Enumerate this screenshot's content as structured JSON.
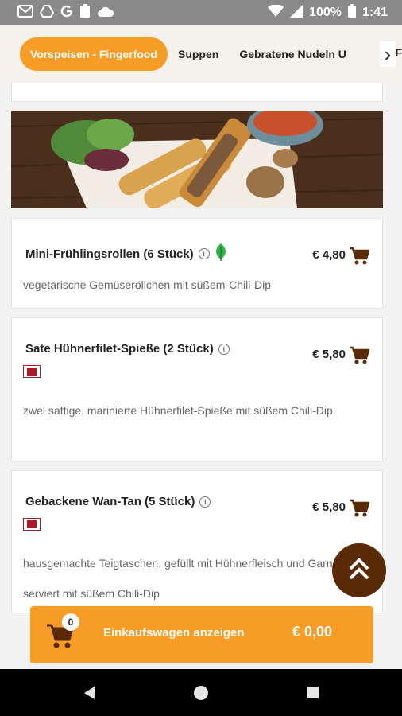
{
  "status": {
    "left_icons": [
      "gmail-icon",
      "drive-icon",
      "google-icon",
      "clipboard-icon",
      "cloud-icon"
    ],
    "battery": "100%",
    "time": "1:41"
  },
  "tabs": {
    "items": [
      "Vorspeisen - Fingerfood",
      "Suppen",
      "Gebratene Nudeln U"
    ],
    "edge_text": "F",
    "arrow": "›"
  },
  "products": [
    {
      "title": "Mini-Frühlingsrollen (6 Stück)",
      "price": "€ 4,80",
      "desc": "vegetarische Gemüseröllchen mit süßem-Chili-Dip",
      "badge": "vegetarian-leaf-icon"
    },
    {
      "title": "Sate Hühnerfilet-Spieße (2 Stück)",
      "price": "€ 5,80",
      "desc": "zwei saftige, marinierte Hühnerfilet-Spieße mit süßem Chili-Dip",
      "badge": "chicken-flag-icon"
    },
    {
      "title": "Gebackene Wan-Tan (5 Stück)",
      "price": "€ 5,80",
      "desc": "hausgemachte Teigtaschen, gefüllt mit Hühnerfleisch und Garnelen, serviert mit süßem Chili-Dip",
      "badge": "chicken-flag-icon"
    }
  ],
  "cart": {
    "count": "0",
    "label": "Einkaufswagen anzeigen",
    "total": "€ 0,00"
  },
  "info_glyph": "i",
  "colors": {
    "accent": "#f79c24",
    "brown": "#5a2a06",
    "leaf": "#2fb34a",
    "flag": "#a81c2a"
  }
}
